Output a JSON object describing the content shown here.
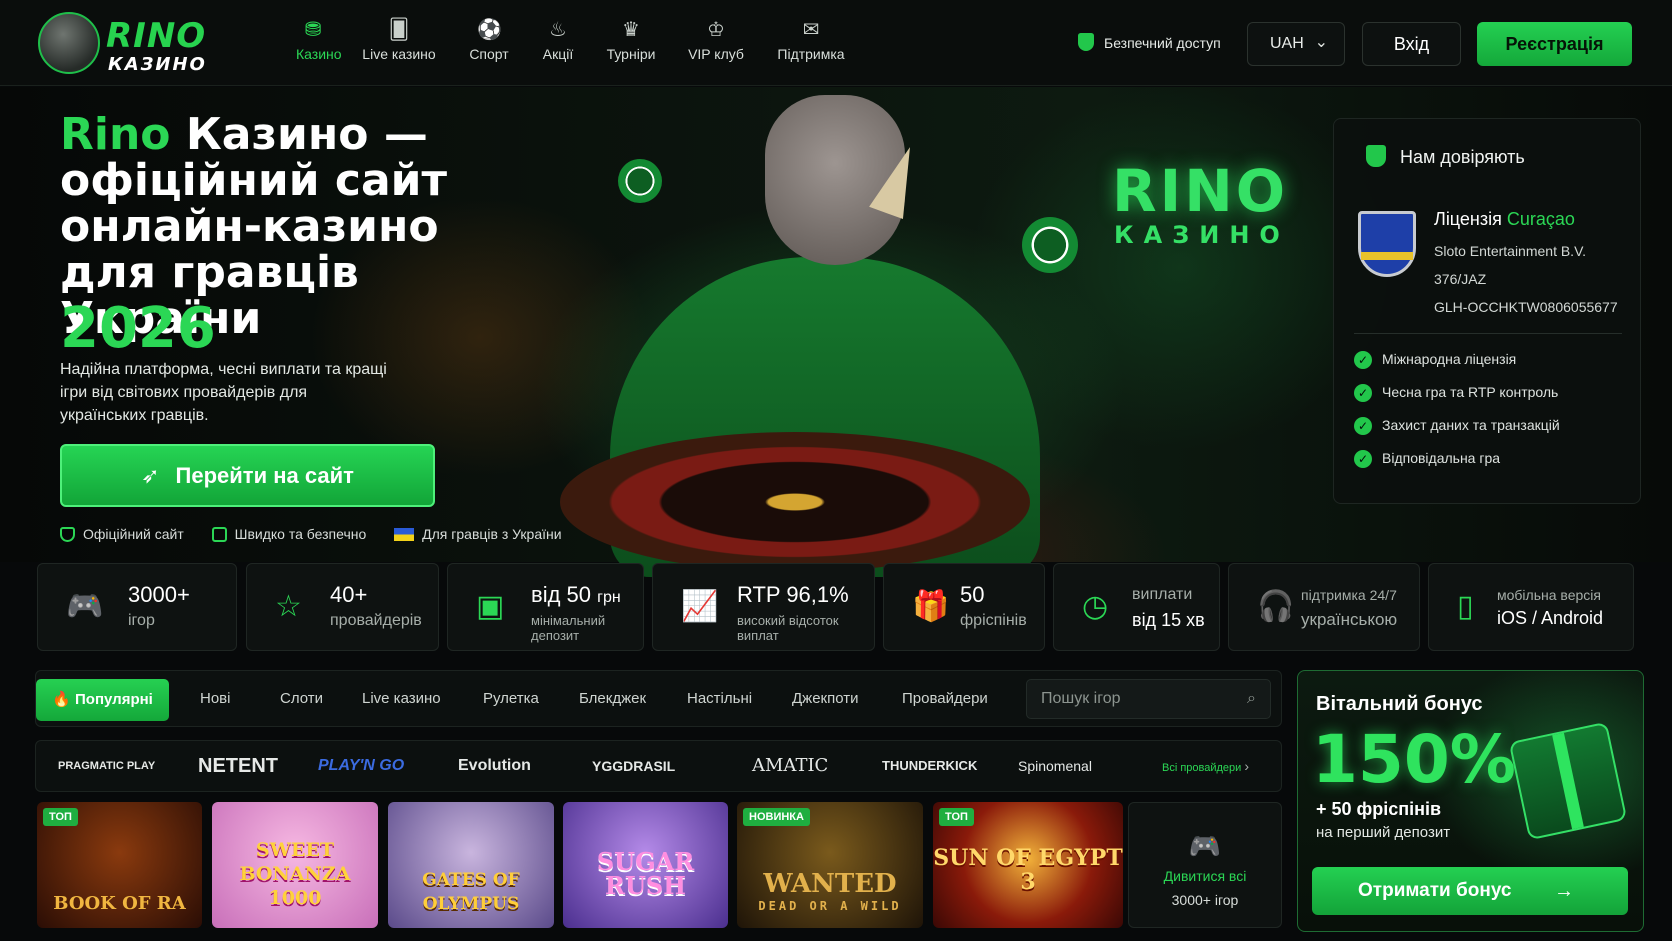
{
  "logo": {
    "word": "RINO",
    "sub": "КАЗИНО"
  },
  "nav": [
    {
      "label": "Казино",
      "icon": "casino-chip-icon",
      "glyph": "⛃"
    },
    {
      "label": "Live казино",
      "icon": "cards-icon",
      "glyph": "🂠"
    },
    {
      "label": "Спорт",
      "icon": "soccer-ball-icon",
      "glyph": "⚽"
    },
    {
      "label": "Акції",
      "icon": "flame-icon",
      "glyph": "♨"
    },
    {
      "label": "Турніри",
      "icon": "trophy-icon",
      "glyph": "♛"
    },
    {
      "label": "VIP клуб",
      "icon": "crown-icon",
      "glyph": "♔"
    },
    {
      "label": "Підтримка",
      "icon": "chat-icon",
      "glyph": "✉"
    }
  ],
  "header": {
    "secure_label": "Безпечний доступ",
    "currency": "UAH",
    "login": "Вхід",
    "register": "Реєстрація"
  },
  "hero": {
    "title_brand": "Rino",
    "title_rest": " Казино — офіційний сайт онлайн-казино для гравців України",
    "year": "2026",
    "subtitle": "Надійна платформа, чесні виплати та кращі ігри від світових провайдерів для українських гравців.",
    "cta": "Перейти на сайт",
    "badges": [
      "Офіційний сайт",
      "Швидко та безпечно",
      "Для гравців з України"
    ],
    "sign_word": "RINO",
    "sign_sub": "КАЗИНО"
  },
  "trust": {
    "title": "Нам довіряють",
    "license_label": "Ліцензія",
    "license_place": "Curaçao",
    "lines": [
      "Sloto Entertainment B.V.",
      "376/JAZ",
      "GLH-OCCHKTW0806055677"
    ],
    "checks": [
      "Міжнародна ліцензія",
      "Чесна гра та RTP контроль",
      "Захист даних та транзакцій",
      "Відповідальна гра"
    ]
  },
  "stats": [
    {
      "big": "3000+",
      "small": "ігор",
      "icon": "gamepad-icon"
    },
    {
      "big": "40+",
      "small": "провайдерів",
      "icon": "star-icon"
    },
    {
      "big": "від 50",
      "unit": "грн",
      "small": "мінімальний депозит",
      "icon": "wallet-icon"
    },
    {
      "big": "RTP 96,1%",
      "small": "високий відсоток виплат",
      "icon": "chart-up-icon"
    },
    {
      "big": "50",
      "small": "фріспінів",
      "icon": "gift-icon"
    },
    {
      "top": "виплати",
      "bottom": "від 15 хв",
      "icon": "clock-icon"
    },
    {
      "top": "підтримка 24/7",
      "bottom": "українською",
      "icon": "headset-icon"
    },
    {
      "top": "мобільна версія",
      "bottom": "iOS / Android",
      "icon": "phone-icon"
    }
  ],
  "tabs": {
    "active": "Популярні",
    "items": [
      "Нові",
      "Слоти",
      "Live казино",
      "Рулетка",
      "Блекджек",
      "Настільні",
      "Джекпоти",
      "Провайдери"
    ],
    "search_placeholder": "Пошук ігор"
  },
  "providers": {
    "items": [
      "PRAGMATIC PLAY",
      "NETENT",
      "PLAY'N GO",
      "Evolution",
      "YGGDRASIL",
      "AMATIC",
      "THUNDERKICK",
      "Spinomenal"
    ],
    "all": "Всі провайдери"
  },
  "games": [
    {
      "name": "BOOK OF RA",
      "tag": "ТОП"
    },
    {
      "name": "SWEET BONANZA 1000",
      "tag": ""
    },
    {
      "name": "GATES OF OLYMPUS",
      "tag": ""
    },
    {
      "name": "SUGAR RUSH",
      "tag": ""
    },
    {
      "name": "WANTED",
      "sub": "DEAD OR A WILD",
      "tag": "НОВИНКА"
    },
    {
      "name": "SUN OF EGYPT 3",
      "tag": "ТОП"
    }
  ],
  "view_all": {
    "line1": "Дивитися всі",
    "line2": "3000+ ігор"
  },
  "bonus": {
    "title": "Вітальний бонус",
    "percent": "150%",
    "freespins": "+ 50 фріспінів",
    "deposit": "на перший депозит",
    "button": "Отримати бонус"
  },
  "colors": {
    "accent": "#2bd755",
    "background": "#07090a"
  }
}
